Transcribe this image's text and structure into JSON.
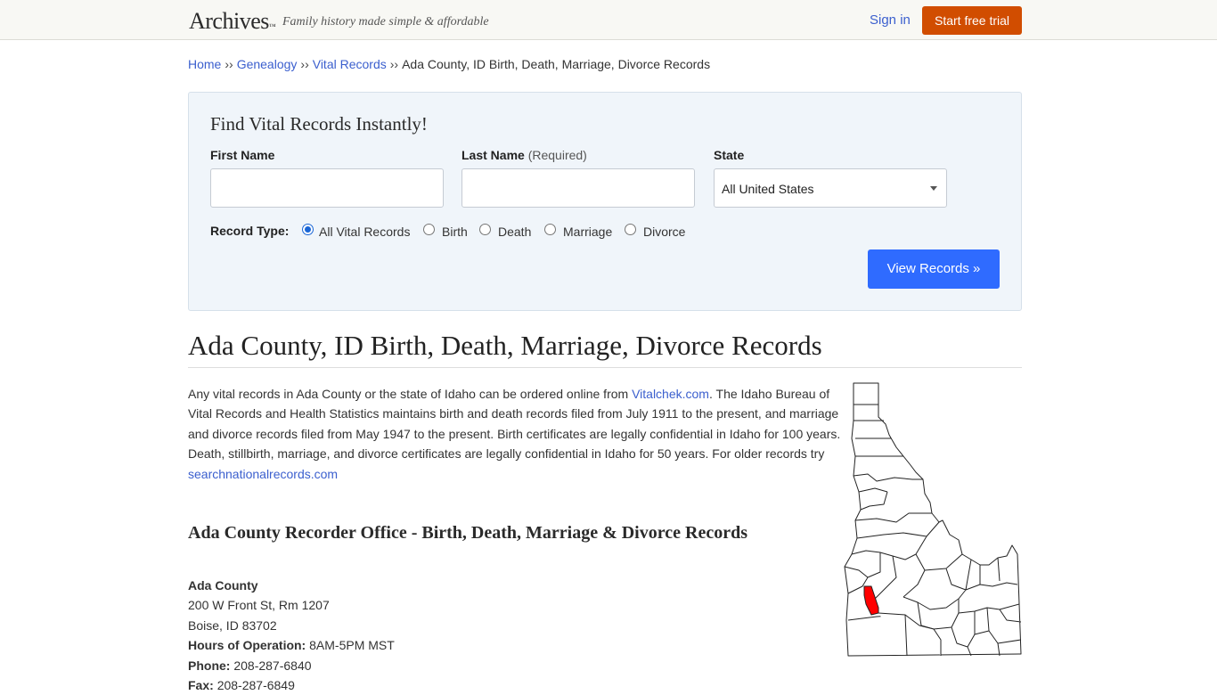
{
  "header": {
    "logo": "Archives",
    "logo_tm": "™",
    "tagline": "Family history made simple & affordable",
    "signin": "Sign in",
    "trial_button": "Start free trial"
  },
  "breadcrumb": {
    "items": [
      "Home",
      "Genealogy",
      "Vital Records"
    ],
    "separator": "››",
    "current": "Ada County, ID Birth, Death, Marriage, Divorce Records"
  },
  "search": {
    "title": "Find Vital Records Instantly!",
    "first_name_label": "First Name",
    "last_name_label": "Last Name",
    "last_name_required": "(Required)",
    "state_label": "State",
    "state_value": "All United States",
    "record_type_label": "Record Type:",
    "record_types": [
      "All Vital Records",
      "Birth",
      "Death",
      "Marriage",
      "Divorce"
    ],
    "selected_record_type": "All Vital Records",
    "submit": "View Records »"
  },
  "page": {
    "title": "Ada County, ID Birth, Death, Marriage, Divorce Records",
    "intro_before_link": "Any vital records in Ada County or the state of Idaho can be ordered online from ",
    "intro_link": "Vitalchek.com",
    "intro_after_link": ". The Idaho Bureau of Vital Records and Health Statistics maintains birth and death records filed from July 1911 to the present, and marriage and divorce records filed from May 1947 to the present. Birth certificates are legally confidential in Idaho for 100 years. Death, stillbirth, marriage, and divorce certificates are legally confidential in Idaho for 50 years. For older records try ",
    "intro_link2": "searchnationalrecords.com",
    "section_title": "Ada County Recorder Office - Birth, Death, Marriage & Divorce Records"
  },
  "office": {
    "name": "Ada County",
    "address1": "200 W Front St, Rm 1207",
    "address2": "Boise, ID 83702",
    "hours_label": "Hours of Operation:",
    "hours": "8AM-5PM MST",
    "phone_label": "Phone:",
    "phone": "208-287-6840",
    "fax_label": "Fax:",
    "fax": "208-287-6849"
  },
  "colors": {
    "accent_orange": "#d14d00",
    "primary_blue": "#2f6bff",
    "link_blue": "#3b5fce",
    "highlight_county": "#ff0000"
  }
}
